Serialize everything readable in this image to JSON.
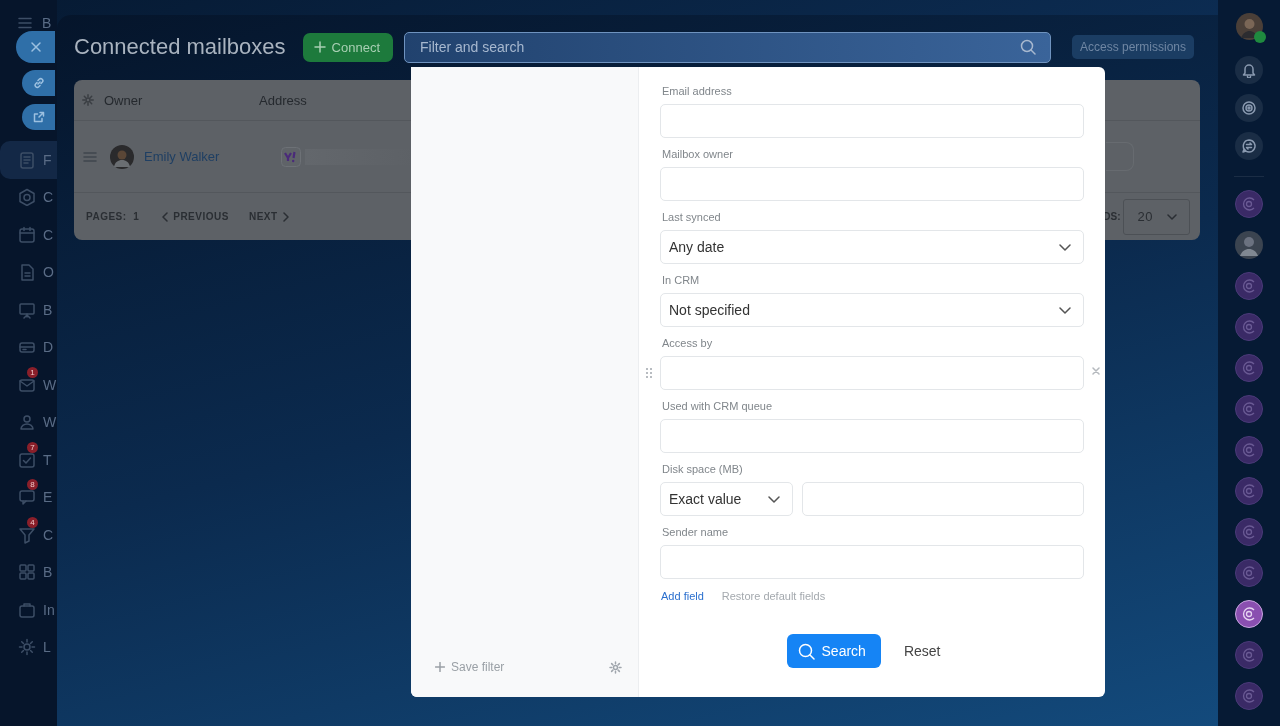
{
  "left_nav": {
    "app_letter": "B",
    "items": [
      {
        "letter": "F",
        "selected": true
      },
      {
        "letter": "C",
        "selected": false
      },
      {
        "letter": "C",
        "selected": false
      },
      {
        "letter": "O",
        "selected": false
      },
      {
        "letter": "B",
        "selected": false
      },
      {
        "letter": "D",
        "selected": false
      },
      {
        "letter": "W",
        "selected": false,
        "badge": "1"
      },
      {
        "letter": "W",
        "selected": false
      },
      {
        "letter": "T",
        "selected": false,
        "badge": "7"
      },
      {
        "letter": "E",
        "selected": false,
        "badge": "8"
      },
      {
        "letter": "C",
        "selected": false,
        "badge": "4"
      },
      {
        "letter": "B",
        "selected": false
      },
      {
        "letter": "In",
        "selected": false
      },
      {
        "letter": "L",
        "selected": false
      }
    ]
  },
  "page": {
    "title": "Connected mailboxes",
    "connect_button": "Connect",
    "search": {
      "placeholder": "Filter and search"
    },
    "access_button": "Access permissions"
  },
  "table": {
    "columns": [
      "Owner",
      "Address"
    ],
    "rows": [
      {
        "owner": "Emily Walker"
      }
    ],
    "footer": {
      "pages_label": "PAGES:",
      "page": "1",
      "previous": "PREVIOUS",
      "next": "NEXT",
      "records_label": "DS:",
      "page_size": "20"
    }
  },
  "filter": {
    "fields": [
      {
        "label": "Email address",
        "kind": "text"
      },
      {
        "label": "Mailbox owner",
        "kind": "text"
      },
      {
        "label": "Last synced",
        "kind": "select",
        "value": "Any date"
      },
      {
        "label": "In CRM",
        "kind": "select",
        "value": "Not specified"
      },
      {
        "label": "Access by",
        "kind": "text",
        "removable": true
      },
      {
        "label": "Used with CRM queue",
        "kind": "text"
      },
      {
        "label": "Disk space (MB)",
        "kind": "range",
        "value": "Exact value"
      },
      {
        "label": "Sender name",
        "kind": "text"
      }
    ],
    "add_field": "Add field",
    "restore_fields": "Restore default fields",
    "save_filter": "Save filter",
    "search_button": "Search",
    "reset_button": "Reset"
  },
  "right_bar": {
    "items": [
      {
        "kind": "channel",
        "selected": false
      },
      {
        "kind": "avatar",
        "selected": false
      },
      {
        "kind": "channel",
        "selected": false
      },
      {
        "kind": "channel",
        "selected": false
      },
      {
        "kind": "channel",
        "selected": false
      },
      {
        "kind": "channel",
        "selected": false
      },
      {
        "kind": "channel",
        "selected": false
      },
      {
        "kind": "channel",
        "selected": false
      },
      {
        "kind": "channel",
        "selected": false
      },
      {
        "kind": "channel",
        "selected": false
      },
      {
        "kind": "channel",
        "selected": true
      },
      {
        "kind": "channel",
        "selected": false
      },
      {
        "kind": "channel",
        "selected": false
      }
    ]
  }
}
